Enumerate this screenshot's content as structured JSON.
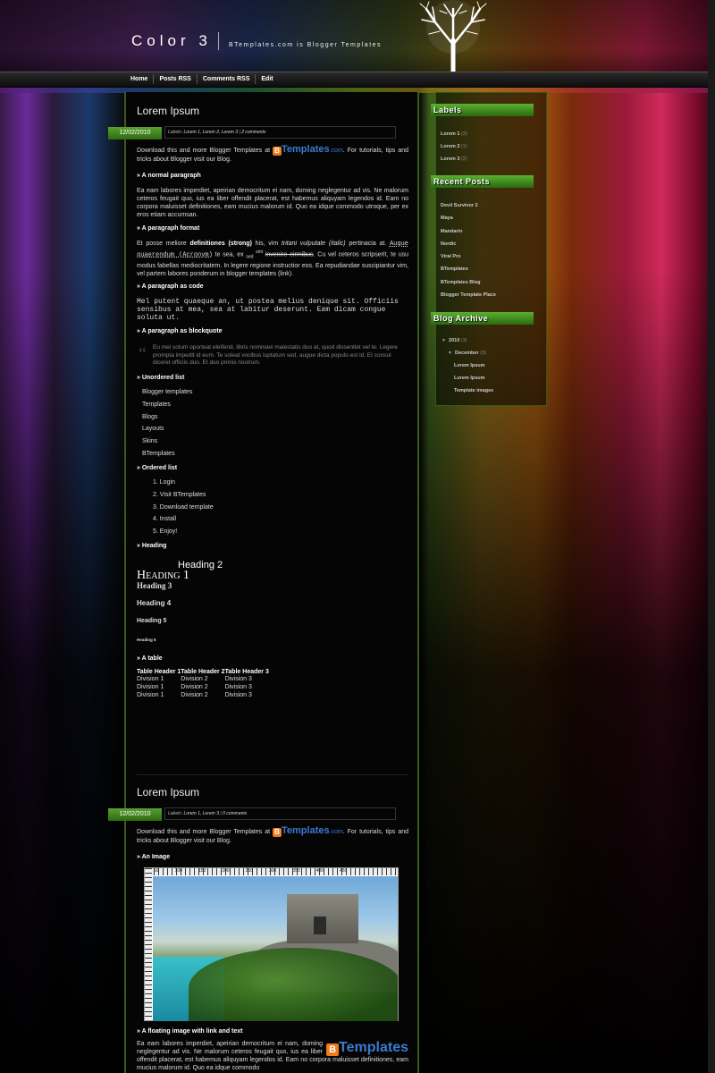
{
  "header": {
    "title": "Color 3",
    "description": "BTemplates.com is Blogger Templates"
  },
  "nav": [
    "Home",
    "Posts RSS",
    "Comments RSS",
    "Edit"
  ],
  "post1": {
    "title": "Lorem Ipsum",
    "date": "12/02/2010",
    "labels_prefix": "Labels:",
    "labels": "Lorem 1, Lorem 2, Lorem 3",
    "comments": "2 comments",
    "intro_a": "Download this and more Blogger Templates at",
    "logo_text": "Templates",
    "logo_domain": ".com",
    "intro_b": ". For tutorials, tips and tricks about Blogger visit our Blog.",
    "sec_normal": "» A normal paragraph",
    "normal_text": "Ea eam labores imperdiet, apeirian democritum ei nam, doming neglegentur ad vis. Ne malorum ceteros feugait quo, ius ea liber offendit placerat, est habemus aliquyam legendos id. Eam no corpora maluisset definitiones, eam mucius malorum id. Quo ea idque commodo utroque, per ex eros etiam accumsan.",
    "sec_format": "» A paragraph format",
    "fmt_1": "Et posse meliore",
    "fmt_strong": "definitiones (strong)",
    "fmt_2": "his, vim",
    "fmt_italic": "tritani vulputate (italic)",
    "fmt_3": "pertinacia at.",
    "fmt_acronym": "Augue quaerendum (Acronym)",
    "fmt_4": "te sea, ex",
    "fmt_sub": "sed",
    "fmt_sup": "sint",
    "fmt_strike": "invenire eirmibus",
    "fmt_5": ". Cu vel ceteros scripserit, te usu modus fabellas mediocritatem. In legere regione instructior eos. Ea repudiandae suscipiantur vim, vel partem labores ponderum in blogger templates (link).",
    "sec_code": "» A paragraph as code",
    "code_text": "Mel putent quaeque an, ut postea melius denique sit. Officiis sensibus at mea, sea at labitur deserunt. Eam dicam congue soluta ut.",
    "sec_quote": "» A paragraph as blockquote",
    "quote_text": "Eu mei solum oporteat eleifend, libris nominavi maiestatis duo at, quod dissentiet vel te. Legere prompta impedit id eum. Te soleat vocibus luptatum sed, augue dicta populo est id. Et consul diceret officiis duo. Et duo primis nostrum.",
    "sec_ul": "» Unordered list",
    "ul": [
      "Blogger templates",
      "Templates",
      "Blogs",
      "Layouts",
      "Skins",
      "BTemplates"
    ],
    "sec_ol": "» Ordered list",
    "ol": [
      "1. Login",
      "2. Visit BTemplates",
      "3. Download template",
      "4. Install",
      "5. Enjoy!"
    ],
    "sec_heading": "» Heading",
    "h1": "Heading 1",
    "h2": "Heading 2",
    "h3": "Heading 3",
    "h4": "Heading 4",
    "h5": "Heading 5",
    "h6": "Heading 6",
    "sec_table": "» A table",
    "table": {
      "headers": [
        "Table Header 1",
        "Table Header 2",
        "Table Header 3"
      ],
      "rows": [
        [
          "Division 1",
          "Division 2",
          "Division 3"
        ],
        [
          "Division 1",
          "Division 2",
          "Division 3"
        ],
        [
          "Division 1",
          "Division 2",
          "Division 3"
        ]
      ]
    }
  },
  "post2": {
    "title": "Lorem Ipsum",
    "date": "12/02/2010",
    "labels_prefix": "Labels:",
    "labels": "Lorem 1, Lorem 3",
    "comments": "0 comments",
    "intro_a": "Download this and more Blogger Templates at",
    "logo_text": "Templates",
    "logo_domain": ".com",
    "intro_b": ". For tutorials, tips and tricks about Blogger visit our Blog.",
    "sec_image": "» An Image",
    "ruler_nums": [
      "50",
      "100",
      "150",
      "200",
      "250",
      "300",
      "350",
      "400",
      "450"
    ],
    "sec_float": "» A floating image with link and text",
    "float_logo": "Templates",
    "float_text": "Ea eam labores imperdiet, apeirian democritum ei nam, doming neglegentur ad vis. Ne malorum ceteros feugait quo, ius ea liber offendit placerat, est habemus aliquyam legendos id. Eam no corpora maluisset definitiones, eam mucius malorum id. Quo ea idque commodo"
  },
  "sidebar": {
    "labels_title": "Labels",
    "labels": [
      {
        "name": "Lorem 1",
        "count": "(3)"
      },
      {
        "name": "Lorem 2",
        "count": "(1)"
      },
      {
        "name": "Lorem 3",
        "count": "(2)"
      }
    ],
    "recent_title": "Recent Posts",
    "recent": [
      "Devil Survivor 2",
      "Maya",
      "Mandarin",
      "Nordic",
      "Viral Pro",
      "BTemplates",
      "BTemplates Blog",
      "Blogger Template Place"
    ],
    "archive_title": "Blog Archive",
    "archive_year": "2010",
    "archive_year_count": "(3)",
    "archive_month": "December",
    "archive_month_count": "(3)",
    "archive_posts": [
      "Lorem Ipsum",
      "Lorem Ipsum",
      "Template images"
    ]
  },
  "colors": {
    "accent_green": "#4a9a22",
    "logo_orange": "#f07a1a",
    "logo_blue": "#3a7ad0"
  }
}
